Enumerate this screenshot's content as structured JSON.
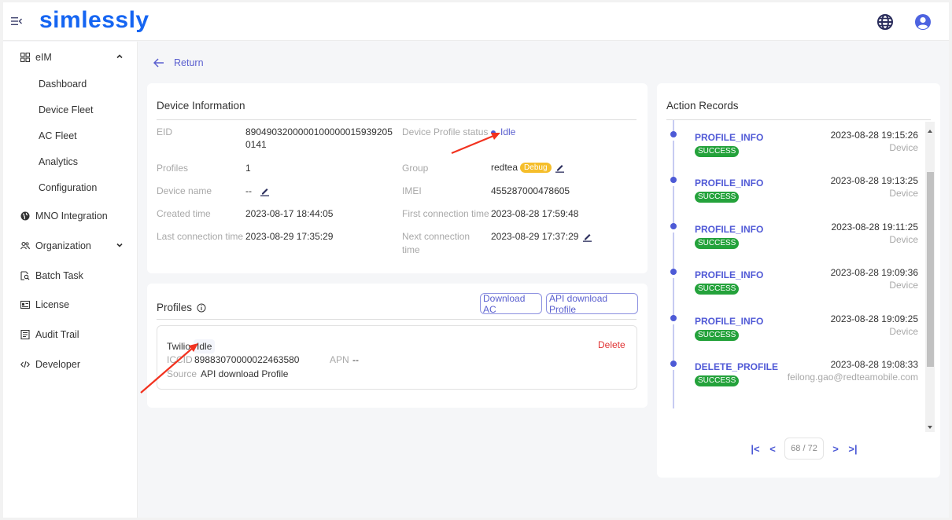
{
  "app": {
    "logo": "simlessly",
    "icons": {
      "menu": "menu-collapse-icon",
      "language": "globe-icon",
      "account": "user-circle-icon"
    }
  },
  "sidebar": {
    "groups": [
      {
        "label": "eIM",
        "icon": "grid-icon",
        "expanded": true,
        "children": [
          "Dashboard",
          "Device Fleet",
          "AC Fleet",
          "Analytics",
          "Configuration"
        ]
      },
      {
        "label": "MNO Integration",
        "icon": "globe-filled-icon"
      },
      {
        "label": "Organization",
        "icon": "users-icon",
        "expanded": false
      },
      {
        "label": "Batch Task",
        "icon": "file-search-icon"
      },
      {
        "label": "License",
        "icon": "id-card-icon"
      },
      {
        "label": "Audit Trail",
        "icon": "list-doc-icon"
      },
      {
        "label": "Developer",
        "icon": "code-icon"
      }
    ]
  },
  "return_label": "Return",
  "device_info": {
    "title": "Device Information",
    "eid_label": "EID",
    "eid_line1": "890490320000010000001593920​5",
    "eid_line2": "0141",
    "profiles_label": "Profiles",
    "profiles_value": "1",
    "device_name_label": "Device name",
    "device_name_value": "--",
    "created_label": "Created time",
    "created_value": "2023-08-17 18:44:05",
    "last_conn_label": "Last connection time",
    "last_conn_value": "2023-08-29 17:35:29",
    "profile_status_label": "Device Profile status",
    "profile_status_value": "Idle",
    "group_label": "Group",
    "group_value": "redtea",
    "group_badge": "Debug",
    "imei_label": "IMEI",
    "imei_value": "455287000478605",
    "first_conn_label": "First connection time",
    "first_conn_value": "2023-08-28 17:59:48",
    "next_conn_label_1": "Next connection",
    "next_conn_label_2": "time",
    "next_conn_value": "2023-08-29 17:37:29"
  },
  "profiles": {
    "title": "Profiles",
    "download_ac": "Download AC",
    "api_download": "API download Profile",
    "items": [
      {
        "name": "Twilio",
        "status": "Idle",
        "iccid_label": "ICCID",
        "iccid": "89883070000022463580",
        "apn_label": "APN",
        "apn": "--",
        "source_label": "Source",
        "source": "API download Profile",
        "delete": "Delete"
      }
    ]
  },
  "action_records": {
    "title": "Action Records",
    "records": [
      {
        "type": "",
        "status": "SUCCESS",
        "time": "",
        "actor": "Device"
      },
      {
        "type": "PROFILE_INFO",
        "status": "SUCCESS",
        "time": "2023-08-28 19:15:26",
        "actor": "Device"
      },
      {
        "type": "PROFILE_INFO",
        "status": "SUCCESS",
        "time": "2023-08-28 19:13:25",
        "actor": "Device"
      },
      {
        "type": "PROFILE_INFO",
        "status": "SUCCESS",
        "time": "2023-08-28 19:11:25",
        "actor": "Device"
      },
      {
        "type": "PROFILE_INFO",
        "status": "SUCCESS",
        "time": "2023-08-28 19:09:36",
        "actor": "Device"
      },
      {
        "type": "PROFILE_INFO",
        "status": "SUCCESS",
        "time": "2023-08-28 19:09:25",
        "actor": "Device"
      },
      {
        "type": "DELETE_PROFILE",
        "status": "SUCCESS",
        "time": "2023-08-28 19:08:33",
        "actor": "feilong.gao@redteamobile.com"
      }
    ],
    "pagination": {
      "current": 68,
      "total": 72,
      "display": "68 / 72",
      "first": "|<",
      "prev": "<",
      "next": ">",
      "last": ">|"
    }
  },
  "colors": {
    "brand": "#1565f2",
    "accent": "#5059d6",
    "success": "#24a23b",
    "danger": "#e03333",
    "debug": "#f5be2b"
  }
}
